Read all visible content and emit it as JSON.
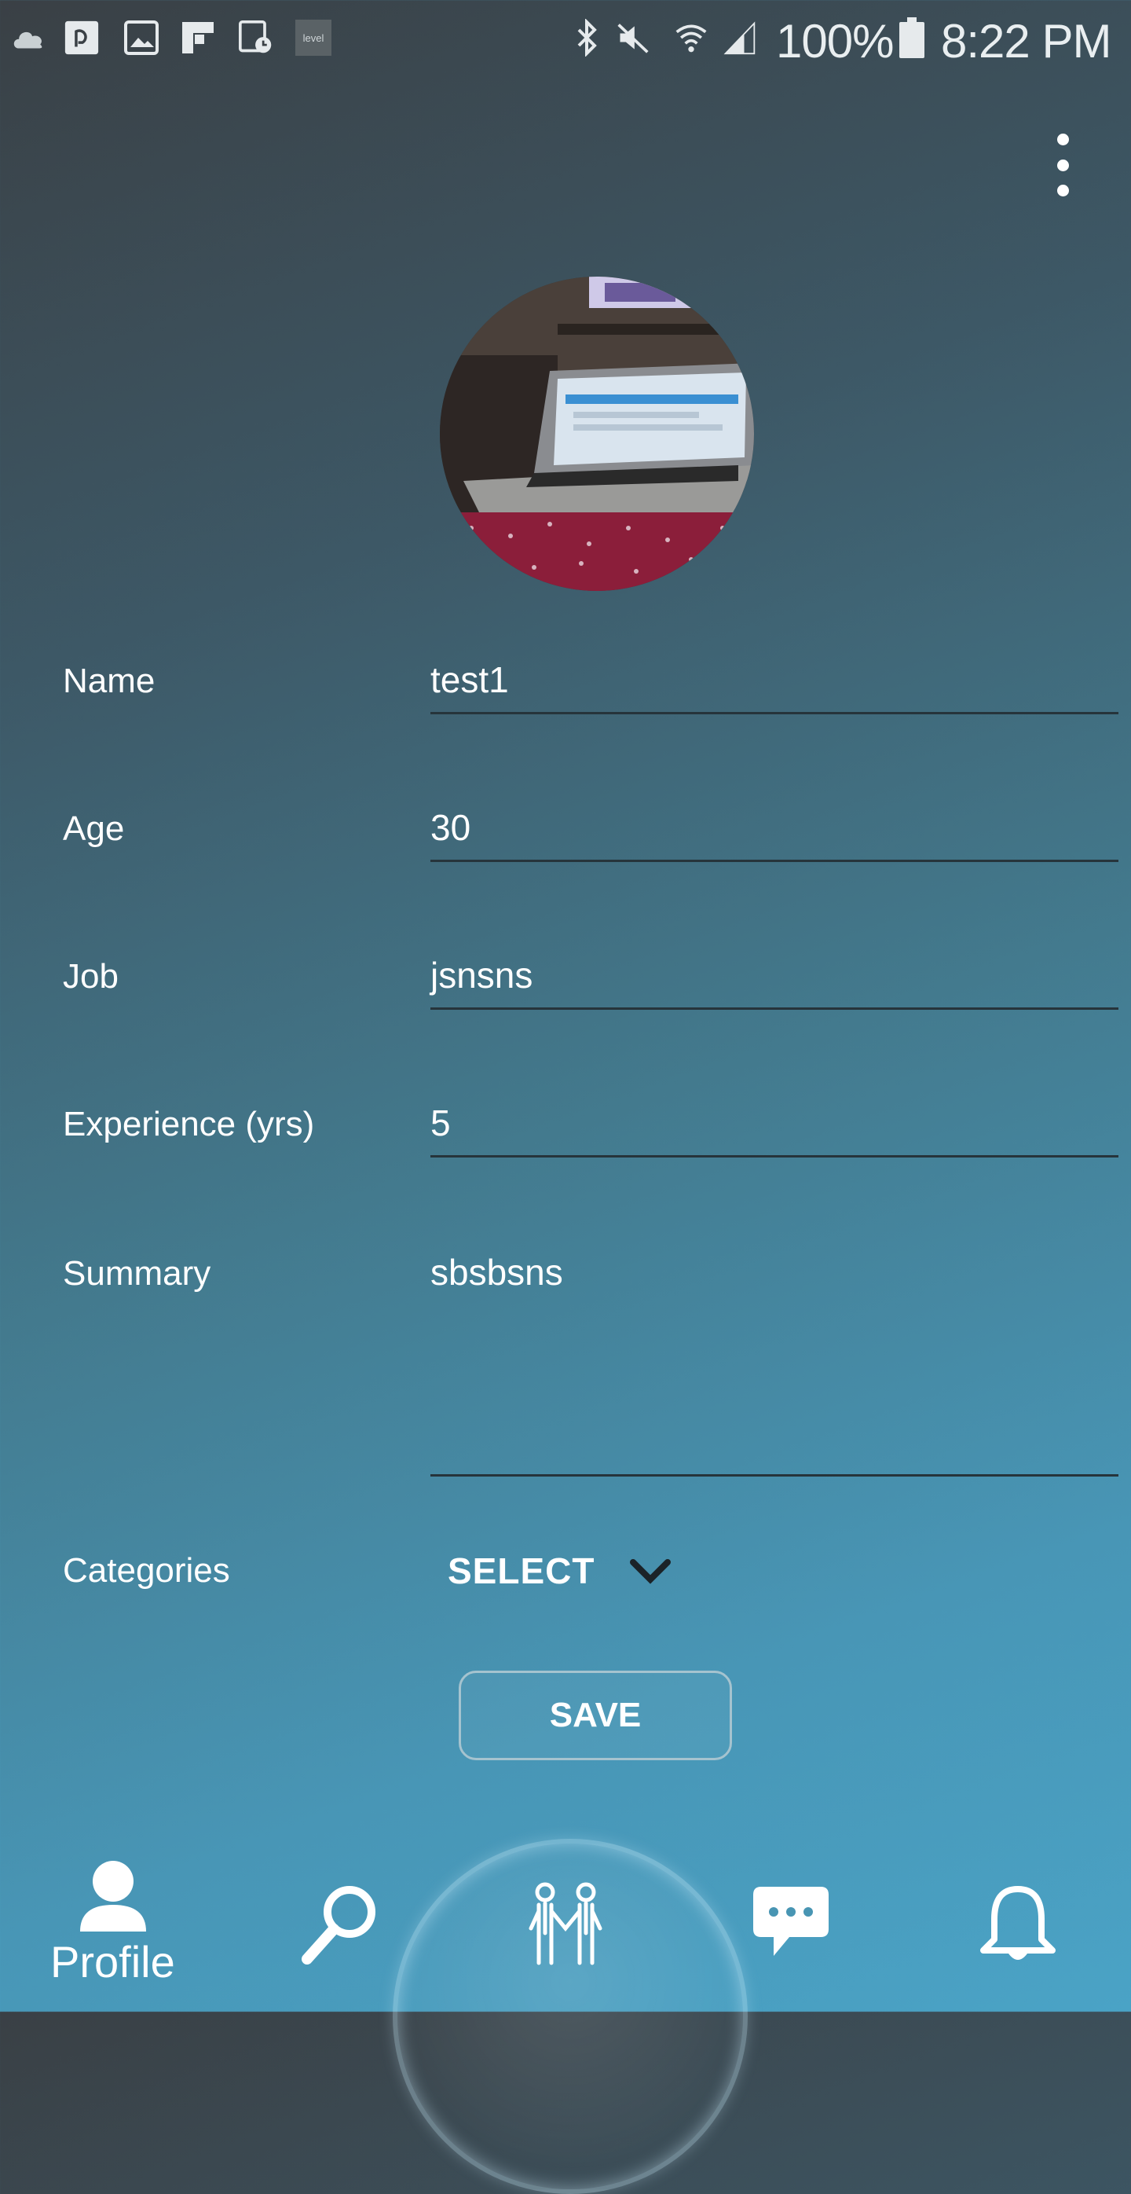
{
  "status_bar": {
    "battery": "100%",
    "time": "8:22 PM",
    "icons": [
      "cloud-icon",
      "p-app-icon",
      "gallery-icon",
      "flipboard-icon",
      "screenshot-timer-icon",
      "level-icon",
      "bluetooth-icon",
      "mute-icon",
      "wifi-icon",
      "signal-icon",
      "battery-icon"
    ],
    "level_icon_text": "level"
  },
  "header": {
    "overflow_icon": "more-vertical-icon"
  },
  "profile": {
    "avatar_alt": "avatar-photo"
  },
  "form": {
    "name": {
      "label": "Name",
      "value": "test1"
    },
    "age": {
      "label": "Age",
      "value": "30"
    },
    "job": {
      "label": "Job",
      "value": "jsnsns"
    },
    "experience": {
      "label": "Experience (yrs)",
      "value": "5"
    },
    "summary": {
      "label": "Summary",
      "value": "sbsbsns"
    },
    "categories": {
      "label": "Categories",
      "selected": "SELECT"
    },
    "save_label": "SAVE"
  },
  "bottom_nav": {
    "profile_label": "Profile",
    "items": [
      "profile-icon",
      "search-icon",
      "match-icon",
      "chat-icon",
      "notifications-icon"
    ]
  },
  "colors": {
    "background_top": "#3a4045",
    "background_bottom": "#4aa3c6",
    "field_underline": "#26343b"
  }
}
